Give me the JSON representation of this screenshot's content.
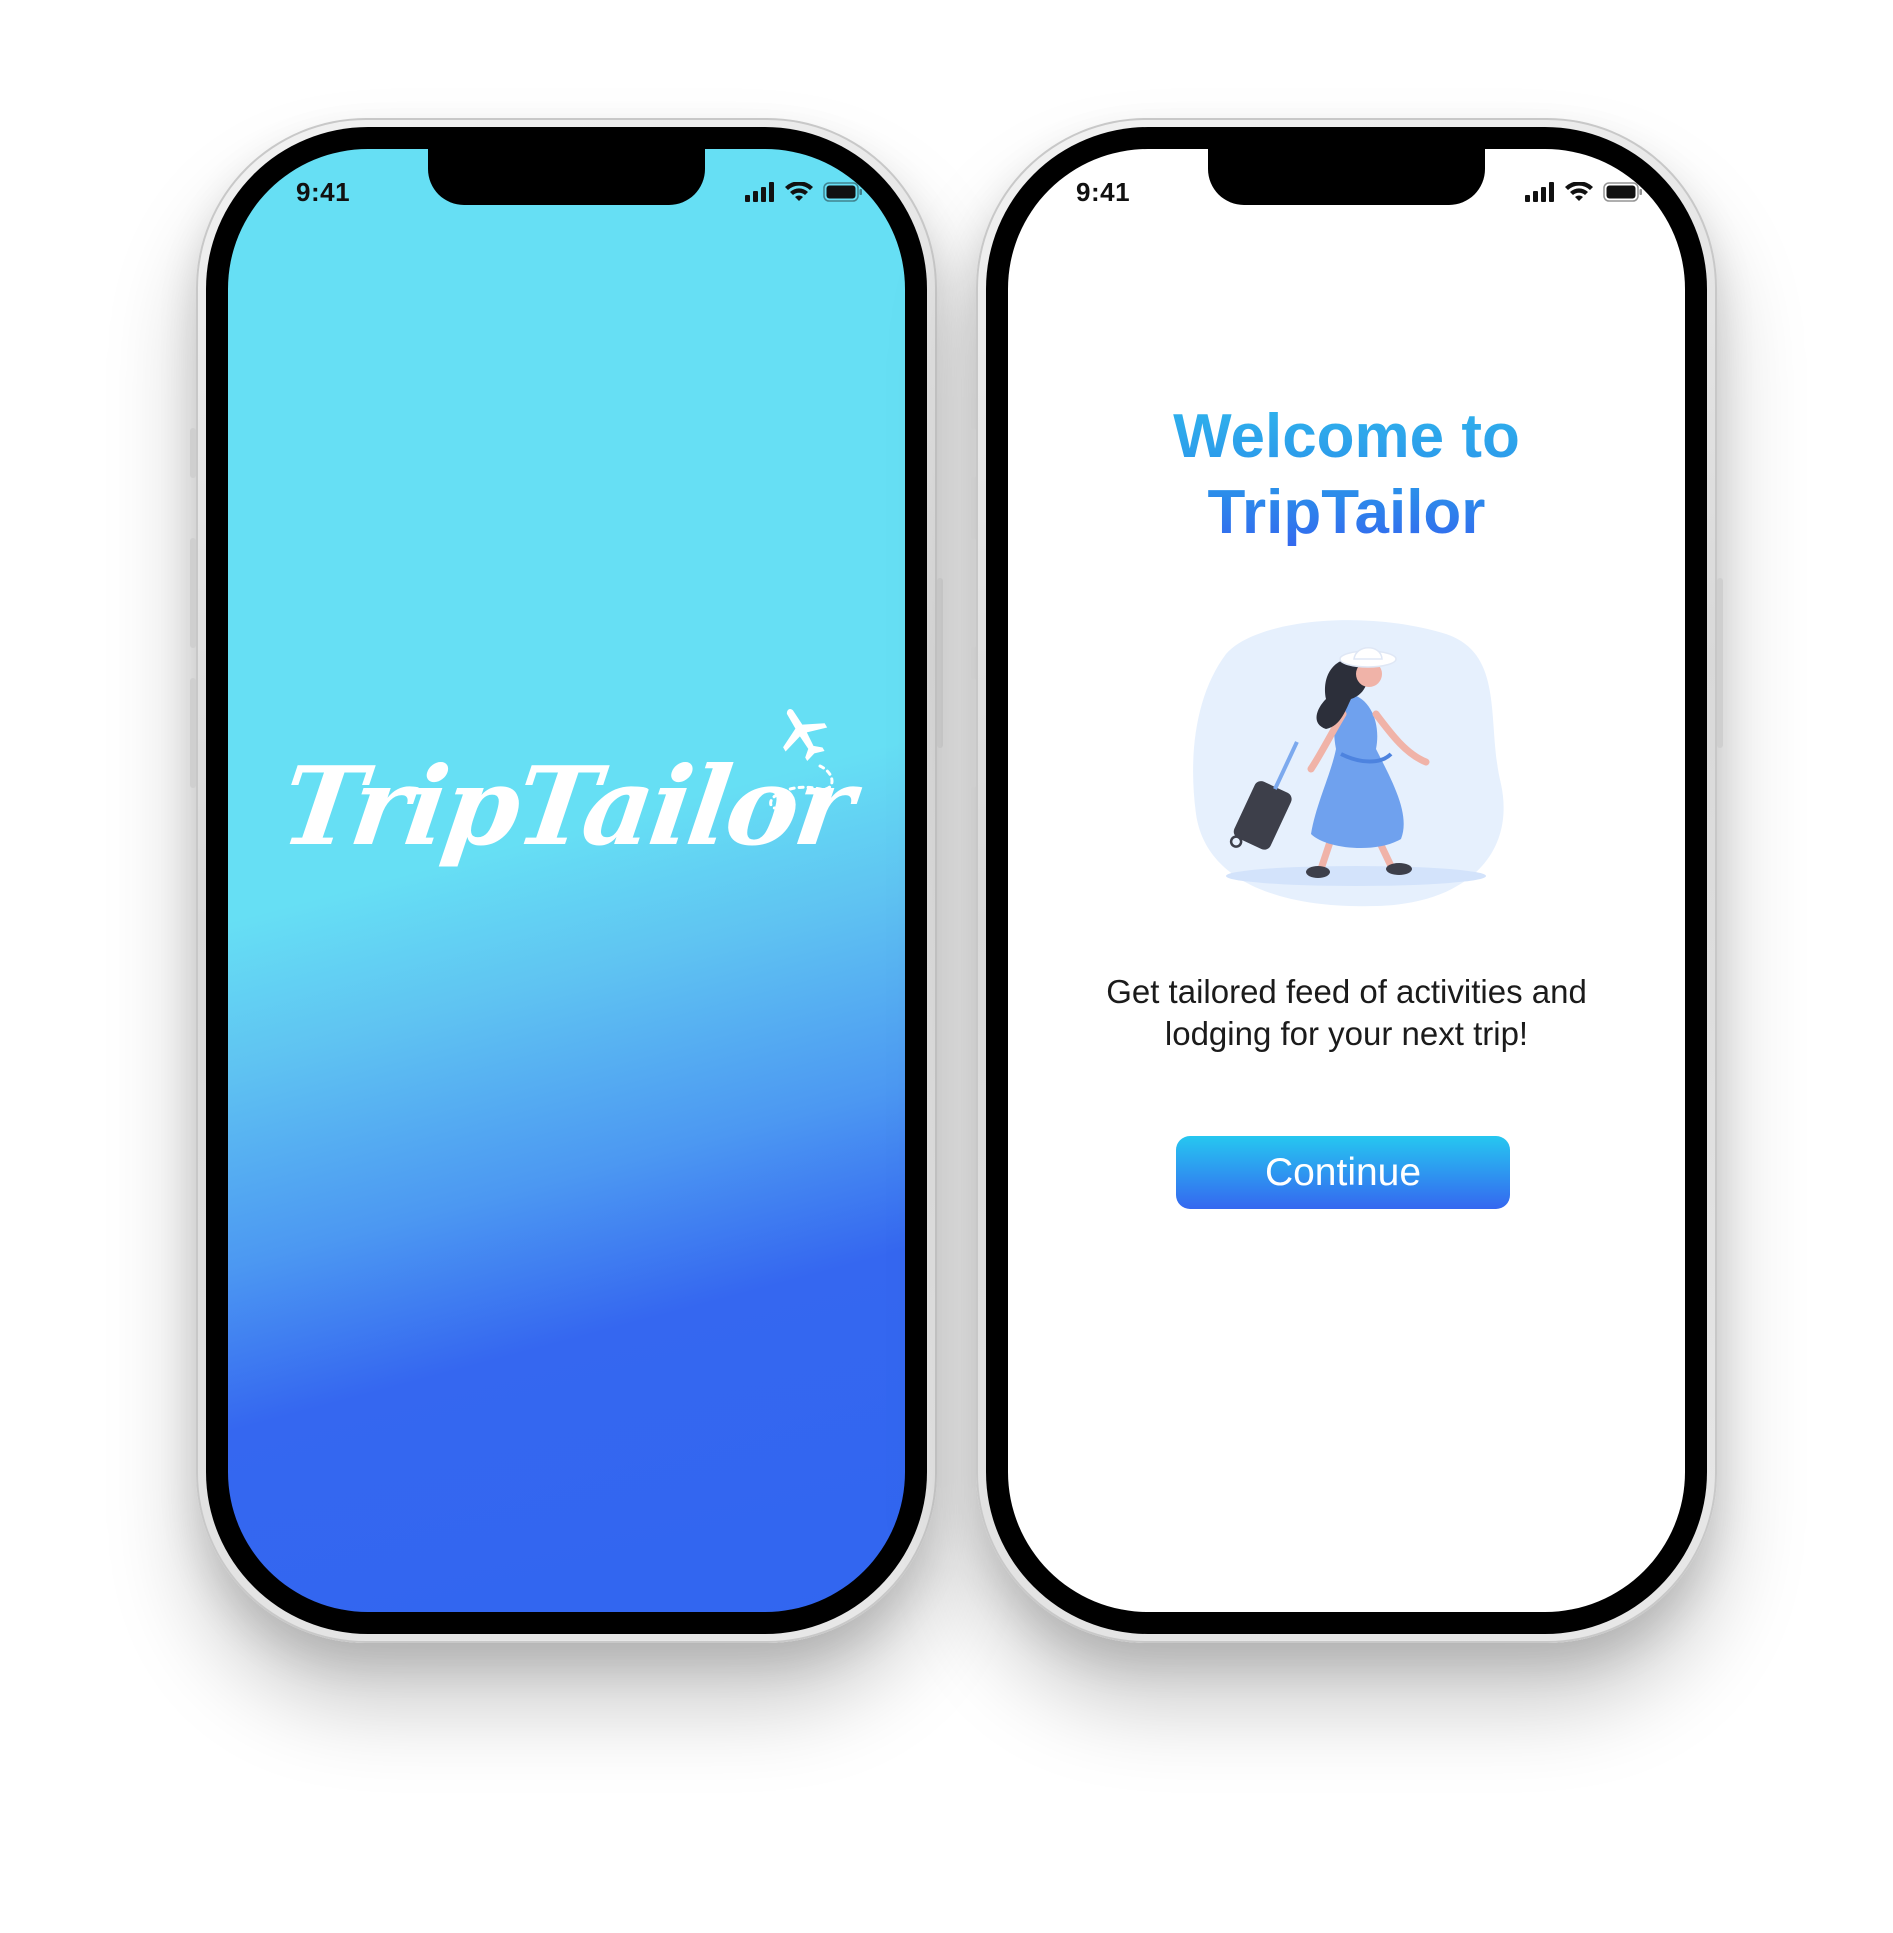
{
  "status_bar": {
    "time": "9:41"
  },
  "splash_screen": {
    "logo_text": "TripTailor",
    "background_colors": [
      "#66dff4",
      "#3166f0"
    ]
  },
  "welcome_screen": {
    "title_line1": "Welcome to",
    "title_line2": "TripTailor",
    "description_line1": "Get tailored feed of activities and",
    "description_line2": "lodging for your next trip!",
    "continue_label": "Continue",
    "accent_colors": [
      "#26c7f0",
      "#3567f0"
    ]
  },
  "icons": [
    "signal-icon",
    "wifi-icon",
    "battery-icon",
    "airplane-icon"
  ]
}
